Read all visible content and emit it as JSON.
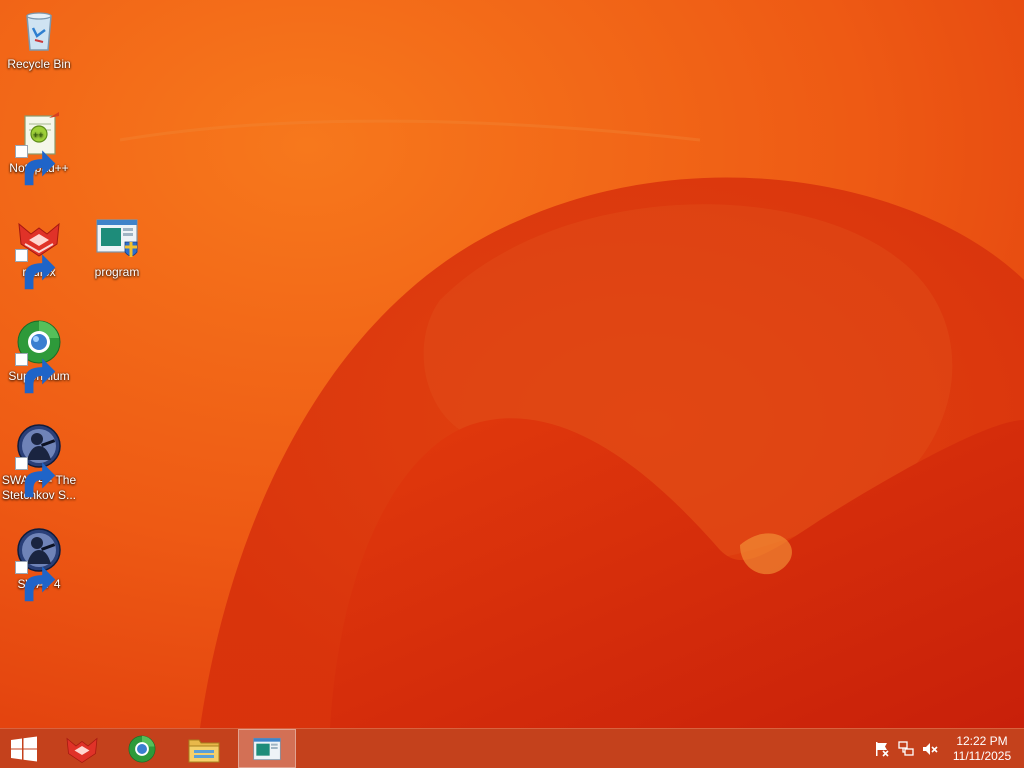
{
  "desktop": {
    "icons": [
      {
        "label": "Recycle Bin",
        "icon": "recycle-bin-icon"
      },
      {
        "label": "Notepad++",
        "icon": "notepad-plus-plus-icon"
      },
      {
        "label": "r3dfox",
        "icon": "r3dfox-icon"
      },
      {
        "label": "program",
        "icon": "program-icon"
      },
      {
        "label": "Supermium",
        "icon": "supermium-icon"
      },
      {
        "label": "SWAT 4 - The Stetchkov S...",
        "icon": "swat4-icon"
      },
      {
        "label": "SWAT 4",
        "icon": "swat4-icon"
      }
    ],
    "wallpaper_colors": [
      "#f05a14",
      "#d8280c",
      "#ee6a1e"
    ]
  },
  "taskbar": {
    "start_icon": "windows-start-icon",
    "pinned": [
      {
        "icon": "r3dfox-icon",
        "active": false
      },
      {
        "icon": "supermium-icon",
        "active": false
      },
      {
        "icon": "file-explorer-icon",
        "active": false
      },
      {
        "icon": "program-icon",
        "active": true
      }
    ],
    "tray": [
      "action-center-flag-icon",
      "network-icon",
      "volume-muted-icon"
    ],
    "clock": {
      "time": "12:22 PM",
      "date": "11/11/2025"
    },
    "color": "#c4411c"
  }
}
